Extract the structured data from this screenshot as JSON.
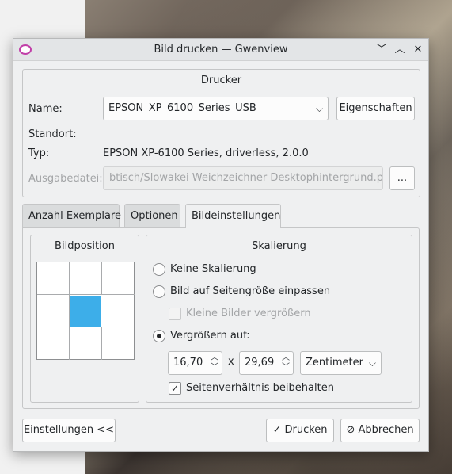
{
  "window": {
    "title": "Bild drucken — Gwenview"
  },
  "printer": {
    "group_title": "Drucker",
    "name_label": "Name:",
    "name_value": "EPSON_XP_6100_Series_USB",
    "properties_button": "Eigenschaften",
    "location_label": "Standort:",
    "type_label": "Typ:",
    "type_value": "EPSON XP-6100 Series, driverless, 2.0.0",
    "output_label": "Ausgabedatei:",
    "output_value": "btisch/Slowakei Weichzeichner Desktophintergrund.pdf",
    "browse_button": "..."
  },
  "tabs": [
    {
      "label": "Anzahl Exemplare",
      "active": false
    },
    {
      "label": "Optionen",
      "active": false
    },
    {
      "label": "Bildeinstellungen",
      "active": true
    }
  ],
  "position": {
    "title": "Bildposition",
    "selected": "center"
  },
  "scaling": {
    "title": "Skalierung",
    "no_scaling": "Keine Skalierung",
    "fit_page": "Bild auf Seitengröße einpassen",
    "enlarge_small": "Kleine Bilder vergrößern",
    "scale_to": "Vergrößern auf:",
    "width": "16,70",
    "times": "x",
    "height": "29,69",
    "unit": "Zentimeter",
    "keep_ratio": "Seitenverhältnis beibehalten"
  },
  "footer": {
    "settings_button": "Einstellungen <<",
    "print_button": "Drucken",
    "cancel_button": "Abbrechen"
  }
}
